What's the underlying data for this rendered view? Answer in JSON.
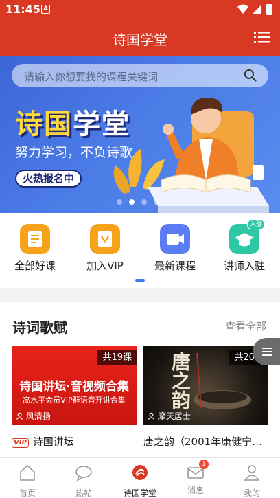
{
  "status_bar": {
    "time": "11:45",
    "notification_icon": "A"
  },
  "app_bar": {
    "title": "诗国学堂",
    "menu_icon": "list-icon"
  },
  "banner": {
    "search_placeholder": "请输入你想要找的课程关键词",
    "title_part1": "诗国",
    "title_part2": "学堂",
    "subtitle": "努力学习，不负诗歌",
    "button": "火热报名中",
    "dots": 4,
    "active_dot": 1
  },
  "categories": [
    {
      "label": "全部好课",
      "icon": "course-book-icon",
      "color": "#f7a21b"
    },
    {
      "label": "加入VIP",
      "icon": "vip-icon",
      "color": "#f7a21b"
    },
    {
      "label": "最新课程",
      "icon": "video-icon",
      "color": "#5b7cf2"
    },
    {
      "label": "讲师入驻",
      "icon": "graduation-cap-icon",
      "color": "#2ec9a4",
      "badge": "入驻"
    }
  ],
  "section": {
    "title": "诗词歌赋",
    "more": "查看全部"
  },
  "cards": [
    {
      "count": "共19课",
      "thumb_title": "诗国讲坛·音视频合集",
      "thumb_subtitle": "高水平会员VIP群语音开讲合集",
      "author": "风清扬",
      "vip_tag": "VIP",
      "title": "诗国讲坛"
    },
    {
      "count": "共20课",
      "thumb_title": "唐之韵",
      "author": "摩天居士",
      "title": "唐之韵（2001年康健宁…"
    }
  ],
  "bottom_nav": [
    {
      "label": "首页",
      "icon": "home-icon"
    },
    {
      "label": "热帖",
      "icon": "chat-icon"
    },
    {
      "label": "诗国学堂",
      "icon": "school-logo-icon",
      "active": true
    },
    {
      "label": "消息",
      "icon": "mail-icon",
      "badge": "1"
    },
    {
      "label": "我的",
      "icon": "user-icon"
    }
  ],
  "colors": {
    "primary": "#d93823",
    "accent": "#3a7ef0",
    "banner": "#4b7be6",
    "gold": "#ffd83b"
  }
}
